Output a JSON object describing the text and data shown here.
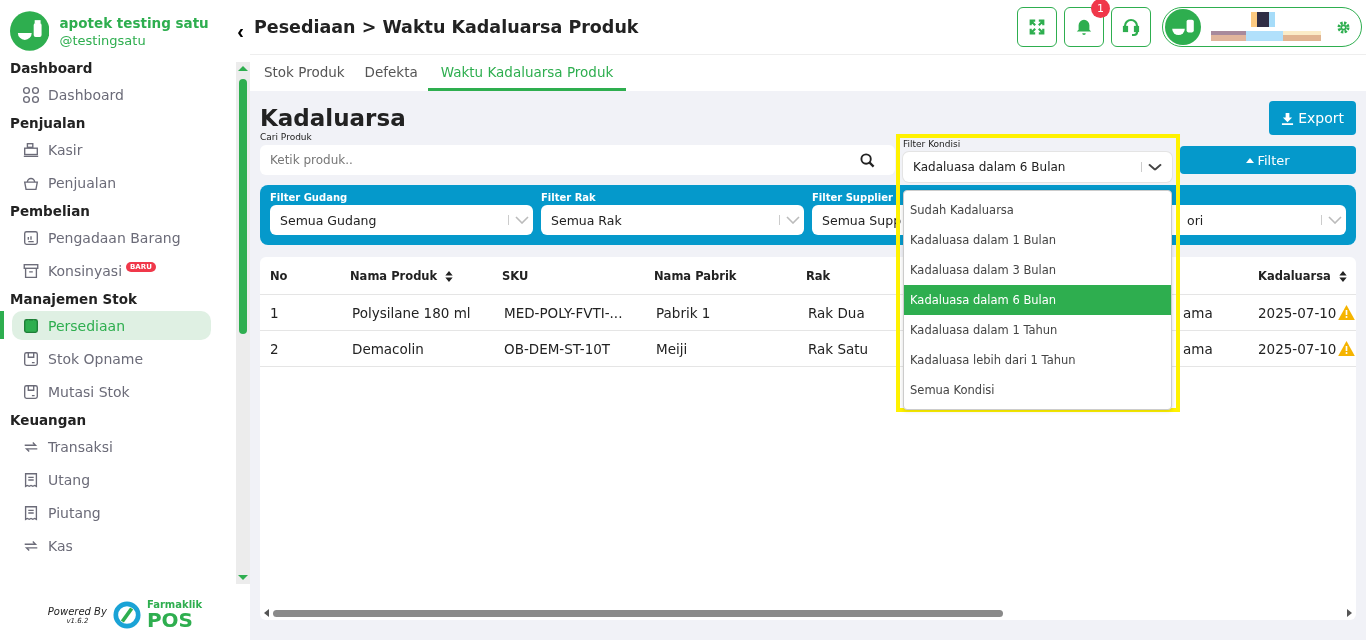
{
  "sidebar": {
    "store_name": "apotek testing satu",
    "username": "@testingsatu",
    "collapse_icon": "‹",
    "sections": [
      {
        "title": "Dashboard",
        "items": [
          {
            "label": "Dashboard",
            "kind": "grid",
            "selected": false
          }
        ]
      },
      {
        "title": "Penjualan",
        "items": [
          {
            "label": "Kasir",
            "kind": "register",
            "selected": false
          },
          {
            "label": "Penjualan",
            "kind": "basket",
            "selected": false
          }
        ]
      },
      {
        "title": "Pembelian",
        "items": [
          {
            "label": "Pengadaan Barang",
            "kind": "board",
            "selected": false
          },
          {
            "label": "Konsinyasi",
            "kind": "archive",
            "selected": false,
            "badge": "BARU"
          }
        ]
      },
      {
        "title": "Manajemen Stok",
        "items": [
          {
            "label": "Persediaan",
            "kind": "package",
            "selected": true
          },
          {
            "label": "Stok Opname",
            "kind": "package",
            "selected": false
          },
          {
            "label": "Mutasi Stok",
            "kind": "package",
            "selected": false
          }
        ]
      },
      {
        "title": "Keuangan",
        "items": [
          {
            "label": "Transaksi",
            "kind": "arrows",
            "selected": false
          },
          {
            "label": "Utang",
            "kind": "receipt",
            "selected": false
          },
          {
            "label": "Piutang",
            "kind": "receipt",
            "selected": false
          },
          {
            "label": "Kas",
            "kind": "arrows",
            "selected": false
          }
        ]
      }
    ],
    "footer": {
      "powered": "Powered By",
      "version": "v1.6.2",
      "brand_top": "Farmaklik",
      "brand_bottom": "POS"
    }
  },
  "header": {
    "title": "Pesediaan > Waktu Kadaluarsa Produk",
    "notification_count": "1"
  },
  "tabs": [
    {
      "label": "Stok Produk",
      "selected": false
    },
    {
      "label": "Defekta",
      "selected": false
    },
    {
      "label": "Waktu Kadaluarsa Produk",
      "selected": true
    }
  ],
  "page": {
    "title": "Kadaluarsa",
    "export_button": "Export",
    "search": {
      "label": "Cari Produk",
      "placeholder": "Ketik produk.."
    },
    "condition_filter": {
      "label": "Filter Kondisi",
      "value": "Kadaluasa dalam 6 Bulan",
      "expanded": true,
      "options": [
        {
          "label": "Sudah Kadaluarsa",
          "selected": false
        },
        {
          "label": "Kadaluasa dalam 1 Bulan",
          "selected": false
        },
        {
          "label": "Kadaluasa dalam 3 Bulan",
          "selected": false
        },
        {
          "label": "Kadaluasa dalam 6 Bulan",
          "selected": true
        },
        {
          "label": "Kadaluasa dalam 1 Tahun",
          "selected": false
        },
        {
          "label": "Kadaluasa lebih dari 1 Tahun",
          "selected": false
        },
        {
          "label": "Semua Kondisi",
          "selected": false
        }
      ]
    },
    "filter_button": "Filter",
    "filters": [
      {
        "label": "Filter Gudang",
        "value": "Semua Gudang"
      },
      {
        "label": "Filter Rak",
        "value": "Semua Rak"
      },
      {
        "label": "Filter Supplier",
        "value": "Semua Supp"
      },
      {
        "value": "ori"
      }
    ],
    "table": {
      "columns": [
        {
          "label": "No",
          "sortable": false
        },
        {
          "label": "Nama Produk",
          "sortable": true
        },
        {
          "label": "SKU",
          "sortable": false
        },
        {
          "label": "Nama Pabrik",
          "sortable": false
        },
        {
          "label": "Rak",
          "sortable": false
        },
        {
          "sortable": false
        },
        {
          "label": "Kadaluarsa",
          "sortable": true
        }
      ],
      "rows": [
        {
          "cells": [
            "1",
            "Polysilane 180 ml",
            "MED-POLY-FVTI-...",
            "Pabrik 1",
            "Rak Dua",
            "ama",
            "2025-07-10"
          ],
          "warning": true
        },
        {
          "cells": [
            "2",
            "Demacolin",
            "OB-DEM-ST-10T",
            "Meiji",
            "Rak Satu",
            "ama",
            "2025-07-10"
          ],
          "warning": true
        }
      ]
    }
  }
}
